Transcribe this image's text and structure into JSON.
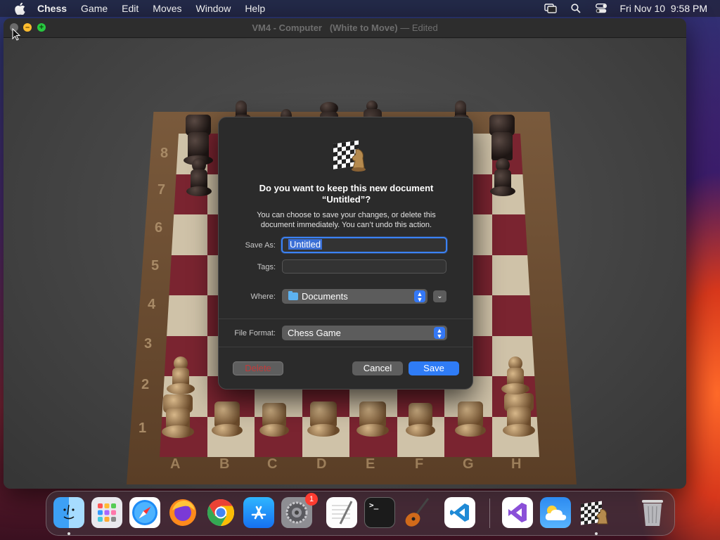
{
  "menubar": {
    "app_name": "Chess",
    "items": [
      "Game",
      "Edit",
      "Moves",
      "Window",
      "Help"
    ],
    "clock": "Fri Nov 10  9:58 PM"
  },
  "window": {
    "title": "VM4 - Computer   (White to Move)",
    "edited": " — Edited"
  },
  "board": {
    "ranks": [
      "8",
      "7",
      "6",
      "5",
      "4",
      "3",
      "2",
      "1"
    ],
    "files": [
      "A",
      "B",
      "C",
      "D",
      "E",
      "F",
      "G",
      "H"
    ]
  },
  "dialog": {
    "heading_line1": "Do you want to keep this new document",
    "heading_line2": "“Untitled”?",
    "message_line1": "You can choose to save your changes, or delete this",
    "message_line2": "document immediately. You can’t undo this action.",
    "save_as_label": "Save As:",
    "save_as_value": "Untitled",
    "tags_label": "Tags:",
    "tags_value": "",
    "where_label": "Where:",
    "where_value": "Documents",
    "format_label": "File Format:",
    "format_value": "Chess Game",
    "delete_label": "Delete",
    "cancel_label": "Cancel",
    "save_label": "Save"
  },
  "dock": {
    "apps": [
      {
        "name": "Finder",
        "icon": "finder-icon"
      },
      {
        "name": "Launchpad",
        "icon": "launchpad-icon"
      },
      {
        "name": "Safari",
        "icon": "safari-icon"
      },
      {
        "name": "Firefox",
        "icon": "firefox-icon"
      },
      {
        "name": "Chrome",
        "icon": "chrome-icon"
      },
      {
        "name": "App Store",
        "icon": "app-store-icon"
      },
      {
        "name": "System Settings",
        "icon": "system-settings-icon",
        "badge": "1"
      },
      {
        "name": "TextEdit",
        "icon": "textedit-icon"
      },
      {
        "name": "Terminal",
        "icon": "terminal-icon"
      },
      {
        "name": "GarageBand",
        "icon": "garageband-icon"
      },
      {
        "name": "VS Code",
        "icon": "vscode-icon"
      },
      {
        "name": "Visual Studio",
        "icon": "visual-studio-icon"
      },
      {
        "name": "Weather",
        "icon": "weather-icon"
      },
      {
        "name": "Chess",
        "icon": "chess-icon"
      },
      {
        "name": "Trash",
        "icon": "trash-icon"
      }
    ],
    "terminal_prompt": ">_"
  }
}
